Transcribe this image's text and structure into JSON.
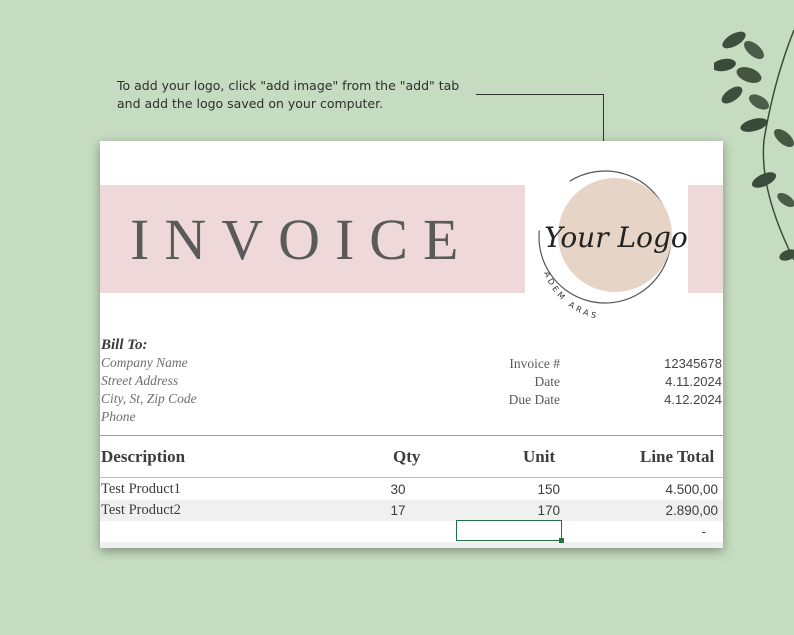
{
  "caption": {
    "text": "To add your logo, click \"add image\" from the \"add\" tab and add the logo saved on your computer."
  },
  "invoice": {
    "title": "INVOICE",
    "logo": {
      "script_text": "Your Logo",
      "arc_text": "ADEM ARAS",
      "circle_color": "#e6d4c6"
    },
    "band_color": "#efd8d9",
    "bill_to": {
      "heading": "Bill To:",
      "lines": [
        "Company Name",
        "Street Address",
        "City, St, Zip Code",
        "Phone"
      ]
    },
    "meta": [
      {
        "label": "Invoice #",
        "value": "12345678"
      },
      {
        "label": "Date",
        "value": "4.11.2024"
      },
      {
        "label": "Due Date",
        "value": "4.12.2024"
      }
    ],
    "table": {
      "headers": {
        "description": "Description",
        "qty": "Qty",
        "unit": "Unit",
        "line_total": "Line Total"
      },
      "rows": [
        {
          "description": "Test Product1",
          "qty": "30",
          "unit": "150",
          "line_total": "4.500,00"
        },
        {
          "description": "Test Product2",
          "qty": "17",
          "unit": "170",
          "line_total": "2.890,00"
        },
        {
          "description": "",
          "qty": "",
          "unit": "",
          "line_total": "-"
        }
      ]
    },
    "selection_color": "#217346"
  }
}
